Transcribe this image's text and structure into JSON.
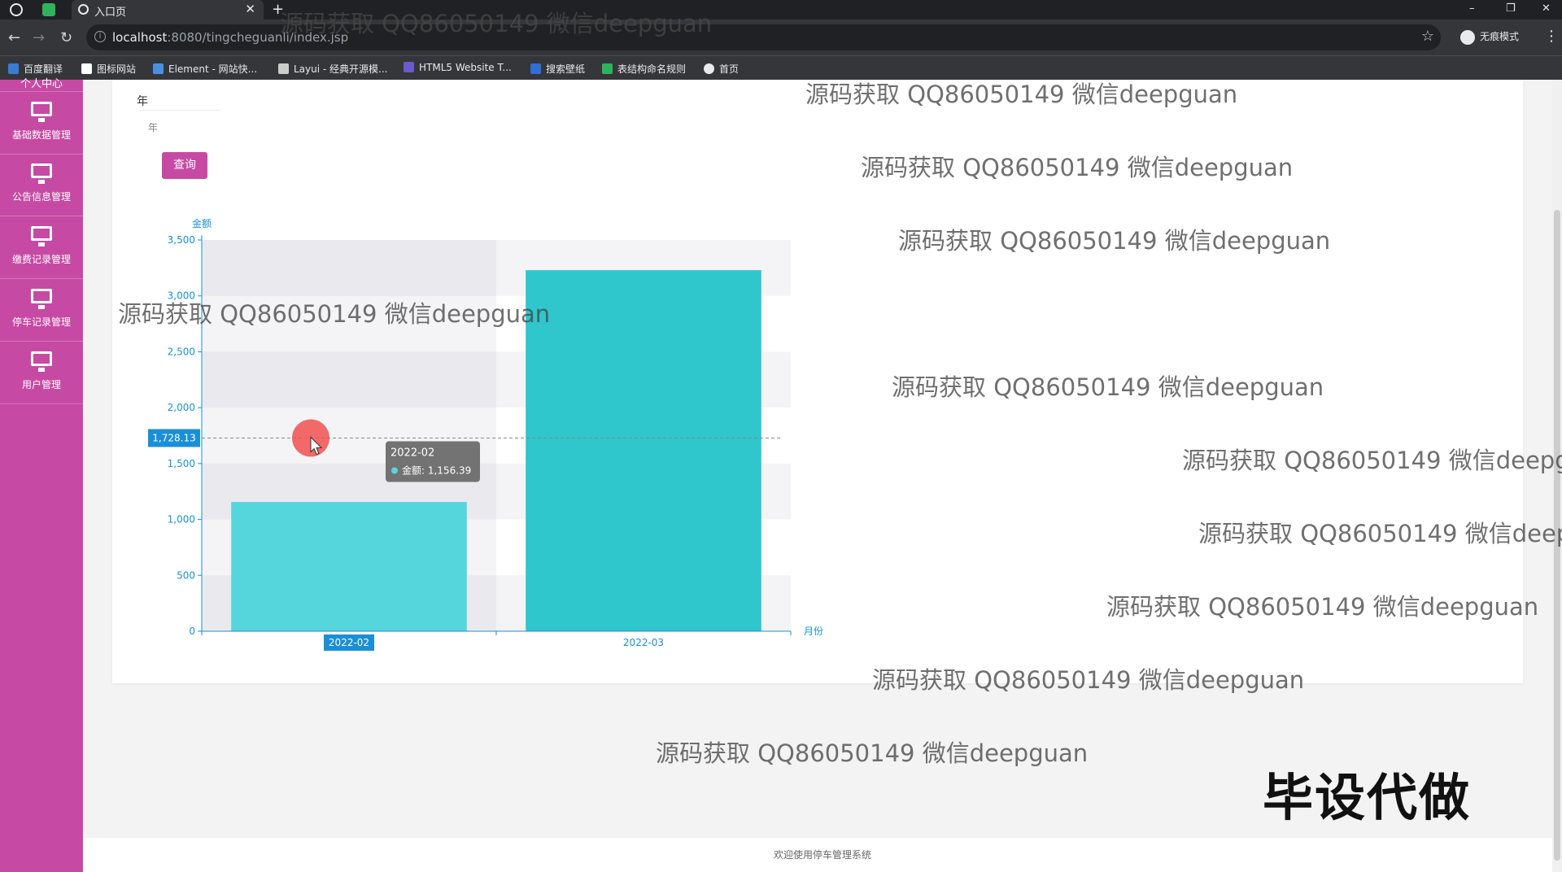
{
  "browser": {
    "tab_title": "入口页",
    "url_host": "localhost",
    "url_path": ":8080/tingcheguanli/index.jsp",
    "incognito_label": "无痕模式",
    "bookmarks": [
      {
        "label": "百度翻译",
        "color": "#3a7bd5"
      },
      {
        "label": "图标网站",
        "color": "#ffffff"
      },
      {
        "label": "Element - 网站快...",
        "color": "#4a90e2"
      },
      {
        "label": "Layui - 经典开源模...",
        "color": "#cccccc"
      },
      {
        "label": "HTML5 Website T...",
        "color": "#6a5acd"
      },
      {
        "label": "搜索壁纸",
        "color": "#2f6fd6"
      },
      {
        "label": "表结构命名规则",
        "color": "#2db35d"
      },
      {
        "label": "首页",
        "color": "#e8eaed"
      }
    ]
  },
  "sidebar": {
    "top_label": "个人中心",
    "items": [
      {
        "label": "基础数据管理",
        "icon": "monitor-icon"
      },
      {
        "label": "公告信息管理",
        "icon": "monitor-icon"
      },
      {
        "label": "缴费记录管理",
        "icon": "monitor-icon"
      },
      {
        "label": "停车记录管理",
        "icon": "monitor-icon"
      },
      {
        "label": "用户管理",
        "icon": "monitor-icon"
      }
    ]
  },
  "filter": {
    "year_label": "年",
    "year_placeholder": "年",
    "query_button": "查询"
  },
  "chart_data": {
    "type": "bar",
    "categories": [
      "2022-02",
      "2022-03"
    ],
    "values": [
      1156.39,
      3230
    ],
    "ylabel": "金额",
    "xlabel": "月份",
    "ylim": [
      0,
      3500
    ],
    "yticks": [
      0,
      500,
      1000,
      1500,
      2000,
      2500,
      3000,
      3500
    ],
    "ytick_labels": [
      "0",
      "500",
      "1,000",
      "1,500",
      "2,000",
      "2,500",
      "3,000",
      "3,500"
    ],
    "bar_colors": [
      "#55d6dc",
      "#2fc6cc"
    ],
    "grid": true,
    "pointer": {
      "value": 1728.13,
      "label": "1,728.13",
      "highlight_category": "2022-02"
    },
    "tooltip": {
      "title": "2022-02",
      "series_label": "金额",
      "value_label": "1,156.39"
    }
  },
  "watermarks": {
    "text": "源码获取 QQ86050149 微信deepguan",
    "stamp": "毕设代做"
  },
  "footer": {
    "text": "欢迎使用停车管理系统"
  },
  "colors": {
    "accent": "#c64aa3",
    "axis": "#1a8fd8",
    "tooltip_bg": "#6b6b6b"
  }
}
